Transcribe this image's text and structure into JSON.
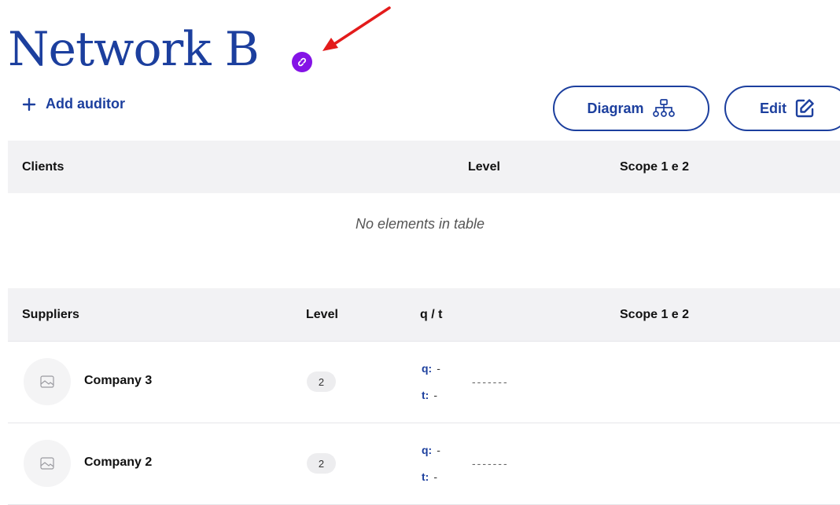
{
  "page": {
    "title": "Network B",
    "add_auditor_label": "Add auditor",
    "diagram_label": "Diagram",
    "edit_label": "Edit"
  },
  "clients_table": {
    "columns": [
      "Clients",
      "Level",
      "Scope 1 e 2"
    ],
    "empty_message": "No elements in table"
  },
  "suppliers_table": {
    "columns": [
      "Suppliers",
      "Level",
      "q / t",
      "Scope 1 e 2"
    ],
    "rows": [
      {
        "name": "Company 3",
        "level": "2",
        "q_label": "q:",
        "q_value": "-",
        "t_label": "t:",
        "t_value": "-",
        "scope": "-------"
      },
      {
        "name": "Company 2",
        "level": "2",
        "q_label": "q:",
        "q_value": "-",
        "t_label": "t:",
        "t_value": "-",
        "scope": "-------"
      }
    ]
  },
  "colors": {
    "primary": "#1c3f9e",
    "link_badge": "#8413e6",
    "annotation_arrow": "#e31b1b",
    "header_bg": "#f2f2f4"
  },
  "icons": [
    "link-icon",
    "plus-icon",
    "network-diagram-icon",
    "edit-icon",
    "image-placeholder-icon",
    "annotation-arrow"
  ]
}
